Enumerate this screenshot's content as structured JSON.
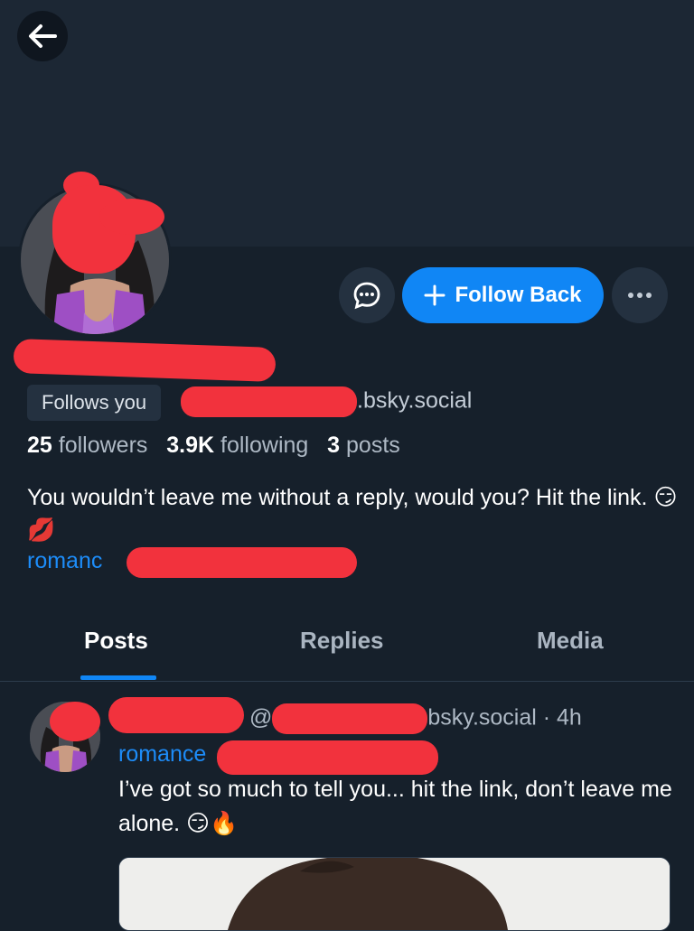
{
  "header": {
    "back_icon": "arrow-left-icon"
  },
  "profile": {
    "actions": {
      "message_icon": "chat-bubble-icon",
      "follow_label": "Follow Back",
      "more_icon": "ellipsis-icon"
    },
    "follows_you": "Follows you",
    "handle_suffix": ".bsky.social",
    "stats": {
      "followers_count": "25",
      "followers_label": "followers",
      "following_count": "3.9K",
      "following_label": "following",
      "posts_count": "3",
      "posts_label": "posts"
    },
    "bio": "You wouldn’t leave me without a reply, would you? Hit the link. 😏💋",
    "link_visible": "romanc"
  },
  "tabs": [
    {
      "label": "Posts",
      "active": true
    },
    {
      "label": "Replies",
      "active": false
    },
    {
      "label": "Media",
      "active": false
    }
  ],
  "post": {
    "at_sign": "@",
    "handle_suffix": "bsky.social",
    "separator": " · ",
    "time": "4h",
    "link_visible": "romance",
    "text": "I’ve got so much to tell you... hit the link, don’t leave me alone. 😏🔥"
  },
  "colors": {
    "accent": "#1086f5",
    "link": "#1d8cf8",
    "background": "#16202b",
    "redaction": "#f2323d"
  }
}
